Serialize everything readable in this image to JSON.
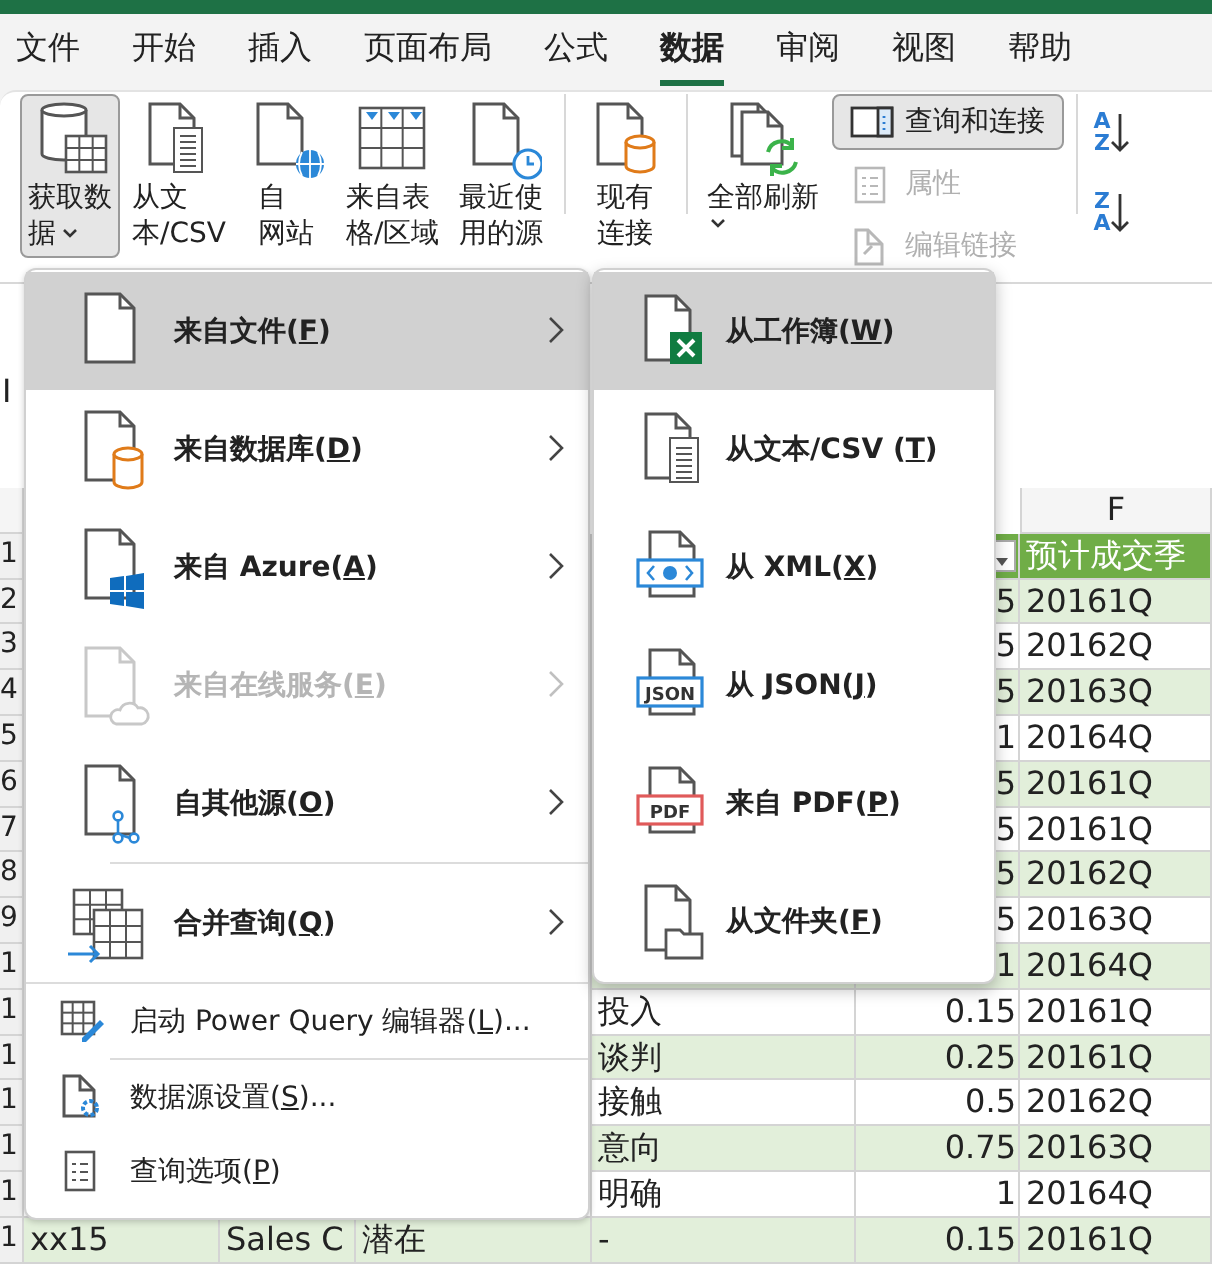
{
  "tabs": [
    {
      "label": "文件",
      "selected": false
    },
    {
      "label": "开始",
      "selected": false
    },
    {
      "label": "插入",
      "selected": false
    },
    {
      "label": "页面布局",
      "selected": false
    },
    {
      "label": "公式",
      "selected": false
    },
    {
      "label": "数据",
      "selected": true
    },
    {
      "label": "审阅",
      "selected": false
    },
    {
      "label": "视图",
      "selected": false
    },
    {
      "label": "帮助",
      "selected": false
    }
  ],
  "ribbon": {
    "groups": [
      {
        "buttons": [
          {
            "kind": "large",
            "lines": [
              "获取数",
              "据"
            ],
            "dropdown": true,
            "pressed": true
          },
          {
            "kind": "large",
            "lines": [
              "从文",
              "本/CSV"
            ],
            "dropdown": false,
            "pressed": false
          },
          {
            "kind": "large",
            "lines": [
              "自",
              "网站"
            ],
            "dropdown": false,
            "pressed": false
          },
          {
            "kind": "large",
            "lines": [
              "来自表",
              "格/区域"
            ],
            "dropdown": false,
            "pressed": false
          },
          {
            "kind": "large",
            "lines": [
              "最近使",
              "用的源"
            ],
            "dropdown": false,
            "pressed": false
          }
        ]
      },
      {
        "buttons": [
          {
            "kind": "large",
            "lines": [
              "现有",
              "连接"
            ],
            "dropdown": false,
            "pressed": false
          }
        ]
      },
      {
        "buttons": [
          {
            "kind": "large",
            "lines": [
              "全部刷新"
            ],
            "dropdown": true,
            "pressed": false
          },
          {
            "kind": "small",
            "label": "查询和连接",
            "pressed": true,
            "disabled": false
          },
          {
            "kind": "small",
            "label": "属性",
            "pressed": false,
            "disabled": true
          },
          {
            "kind": "small",
            "label": "编辑链接",
            "pressed": false,
            "disabled": true
          }
        ]
      },
      {
        "buttons": [
          {
            "kind": "sort",
            "top": "A",
            "bottom": "Z"
          },
          {
            "kind": "sort",
            "top": "Z",
            "bottom": "A"
          }
        ]
      }
    ]
  },
  "menu": {
    "items": [
      {
        "kind": "large",
        "text": "来自文件(",
        "hotkey": "F",
        "tail": ")",
        "selected": true,
        "disabled": false,
        "submenu": true,
        "separator_before": false
      },
      {
        "kind": "large",
        "text": "来自数据库(",
        "hotkey": "D",
        "tail": ")",
        "selected": false,
        "disabled": false,
        "submenu": true,
        "separator_before": false
      },
      {
        "kind": "large",
        "text": "来自 Azure(",
        "hotkey": "A",
        "tail": ")",
        "selected": false,
        "disabled": false,
        "submenu": true,
        "separator_before": false
      },
      {
        "kind": "large",
        "text": "来自在线服务(",
        "hotkey": "E",
        "tail": ")",
        "selected": false,
        "disabled": true,
        "submenu": true,
        "separator_before": false
      },
      {
        "kind": "large",
        "text": "自其他源(",
        "hotkey": "O",
        "tail": ")",
        "selected": false,
        "disabled": false,
        "submenu": true,
        "separator_before": false
      },
      {
        "kind": "large",
        "text": "合并查询(",
        "hotkey": "Q",
        "tail": ")",
        "selected": false,
        "disabled": false,
        "submenu": true,
        "separator_before": true
      },
      {
        "kind": "small",
        "text": "启动 Power Query 编辑器(",
        "hotkey": "L",
        "tail": ")...",
        "selected": false,
        "disabled": false,
        "submenu": false,
        "separator_before": true
      },
      {
        "kind": "small",
        "text": "数据源设置(",
        "hotkey": "S",
        "tail": ")...",
        "selected": false,
        "disabled": false,
        "submenu": false,
        "separator_before": true
      },
      {
        "kind": "small",
        "text": "查询选项(",
        "hotkey": "P",
        "tail": ")",
        "selected": false,
        "disabled": false,
        "submenu": false,
        "separator_before": false
      }
    ]
  },
  "submenu": {
    "items": [
      {
        "text": "从工作簿(",
        "hotkey": "W",
        "tail": ")",
        "selected": true
      },
      {
        "text": "从文本/CSV (",
        "hotkey": "T",
        "tail": ")",
        "selected": false
      },
      {
        "text": "从 XML(",
        "hotkey": "X",
        "tail": ")",
        "selected": false
      },
      {
        "text": "从 JSON(",
        "hotkey": "J",
        "tail": ")",
        "selected": false,
        "badge": "JSON"
      },
      {
        "text": "来自 PDF(",
        "hotkey": "P",
        "tail": ")",
        "selected": false,
        "badge": "PDF"
      },
      {
        "text": "从文件夹(",
        "hotkey": "F",
        "tail": ")",
        "selected": false
      }
    ]
  },
  "sheet": {
    "name_box": "I",
    "column_header": "F",
    "rows": [
      {
        "number": "1",
        "kind": "header",
        "filter": true,
        "f": "预计成交季"
      },
      {
        "number": "2",
        "e": "5",
        "f": "20161Q"
      },
      {
        "number": "3",
        "e": "5",
        "f": "20162Q"
      },
      {
        "number": "4",
        "e": "5",
        "f": "20163Q"
      },
      {
        "number": "5",
        "e": "1",
        "f": "20164Q"
      },
      {
        "number": "6",
        "e": "5",
        "f": "20161Q"
      },
      {
        "number": "7",
        "e": "5",
        "f": "20161Q"
      },
      {
        "number": "8",
        "e": "5",
        "f": "20162Q"
      },
      {
        "number": "9",
        "e": "5",
        "f": "20163Q"
      },
      {
        "number": "1",
        "e": "1",
        "f": "20164Q"
      },
      {
        "number": "1",
        "d": "投入",
        "e": "0.15",
        "f": "20161Q"
      },
      {
        "number": "1",
        "d": "谈判",
        "e": "0.25",
        "f": "20161Q"
      },
      {
        "number": "1",
        "d": "接触",
        "e": "0.5",
        "f": "20162Q"
      },
      {
        "number": "1",
        "d": "意向",
        "e": "0.75",
        "f": "20163Q"
      },
      {
        "number": "1",
        "d": "明确",
        "e": "1",
        "f": "20164Q"
      },
      {
        "number": "1",
        "a": "xx15",
        "b": "Sales C",
        "c": "潜在",
        "d": "-",
        "e": "0.15",
        "f": "20161Q"
      }
    ]
  }
}
